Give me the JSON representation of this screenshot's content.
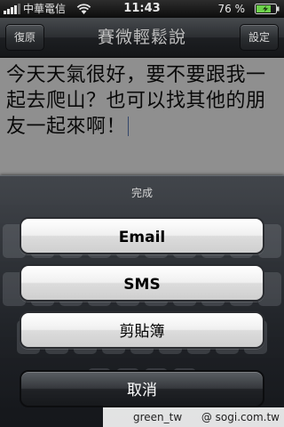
{
  "status_bar": {
    "carrier": "中華電信",
    "time": "11:43",
    "battery_percent": "76 %",
    "battery_level": 0.76
  },
  "nav_bar": {
    "left_button": "復原",
    "title": "賽微輕鬆說",
    "right_button": "設定"
  },
  "message": {
    "text": "今天天氣很好，要不要跟我一起去爬山？也可以找其他的朋友一起來啊！"
  },
  "action_sheet": {
    "title": "完成",
    "buttons": [
      "Email",
      "SMS",
      "剪貼簿"
    ],
    "cancel": "取消"
  },
  "watermark": {
    "user": "green_tw",
    "site": "@ sogi.com.tw"
  },
  "icons": {
    "signal": "signal-bars-icon",
    "wifi": "wifi-icon",
    "battery": "battery-charging-icon"
  },
  "colors": {
    "battery_fill": "#6cd14a",
    "cursor": "#5a7ab8"
  }
}
